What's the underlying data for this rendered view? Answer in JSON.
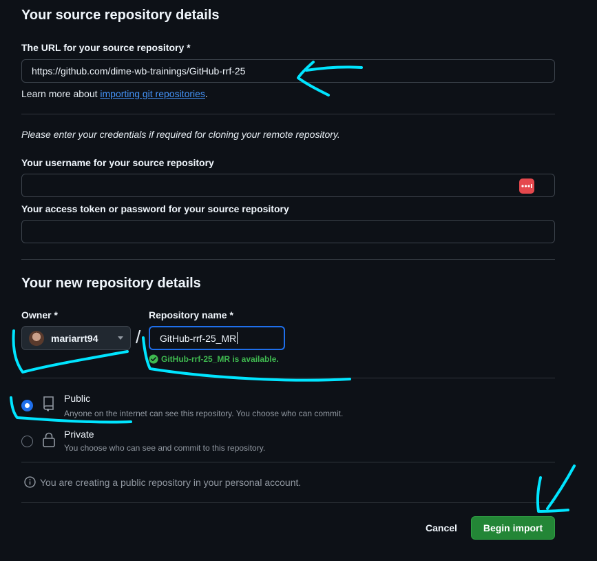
{
  "source": {
    "heading": "Your source repository details",
    "url_label": "The URL for your source repository *",
    "url_value": "https://github.com/dime-wb-trainings/GitHub-rrf-25",
    "learn_prefix": "Learn more about ",
    "learn_link": "importing git repositories",
    "learn_suffix": ".",
    "credentials_note": "Please enter your credentials if required for cloning your remote repository.",
    "username_label": "Your username for your source repository",
    "username_value": "",
    "token_label": "Your access token or password for your source repository",
    "token_value": ""
  },
  "new_repo": {
    "heading": "Your new repository details",
    "owner_label": "Owner *",
    "owner_value": "mariarrt94",
    "slash": "/",
    "name_label": "Repository name *",
    "name_value": "GitHub-rrf-25_MR",
    "availability": "GitHub-rrf-25_MR is available."
  },
  "visibility": {
    "selected": "public",
    "options": [
      {
        "label": "Public",
        "description": "Anyone on the internet can see this repository. You choose who can commit."
      },
      {
        "label": "Private",
        "description": "You choose who can see and commit to this repository."
      }
    ]
  },
  "info_note": "You are creating a public repository in your personal account.",
  "actions": {
    "cancel": "Cancel",
    "begin_import": "Begin import"
  },
  "colors": {
    "background": "#0d1117",
    "accent_blue": "#4493f8",
    "success_green": "#238636",
    "available_green": "#3fb950",
    "annotation_cyan": "#00e5ff"
  }
}
